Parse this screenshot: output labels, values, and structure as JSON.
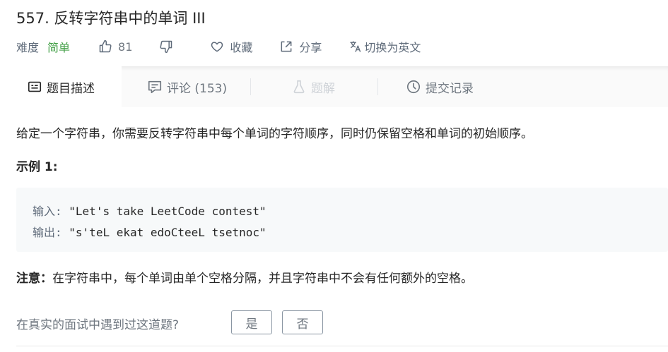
{
  "problem": {
    "title": "557. 反转字符串中的单词 III",
    "difficulty_label": "难度",
    "difficulty": "简单",
    "likes": "81",
    "favorite_label": "收藏",
    "share_label": "分享",
    "translate_label": "切换为英文"
  },
  "tabs": [
    {
      "label": "题目描述",
      "icon": "description-icon",
      "active": true
    },
    {
      "label": "评论 (153)",
      "icon": "comment-icon"
    },
    {
      "label": "题解",
      "icon": "flask-icon",
      "disabled": true
    },
    {
      "label": "提交记录",
      "icon": "clock-icon"
    }
  ],
  "content": {
    "description": "给定一个字符串，你需要反转字符串中每个单词的字符顺序，同时仍保留空格和单词的初始顺序。",
    "example_title": "示例 1:",
    "example": {
      "input_label": "输入:",
      "input_value": "\"Let's take LeetCode contest\"",
      "output_label": "输出:",
      "output_value": "\"s'teL ekat edoCteeL tsetnoc\""
    },
    "note_label": "注意：",
    "note_text": "在字符串中，每个单词由单个空格分隔，并且字符串中不会有任何额外的空格。"
  },
  "interview": {
    "question": "在真实的面试中遇到过这道题?",
    "yes": "是",
    "no": "否"
  },
  "colors": {
    "easy": "#43a047",
    "muted": "#5f6b7a",
    "code_bg": "#f7f9fa",
    "tab_bg": "#fafafa"
  }
}
